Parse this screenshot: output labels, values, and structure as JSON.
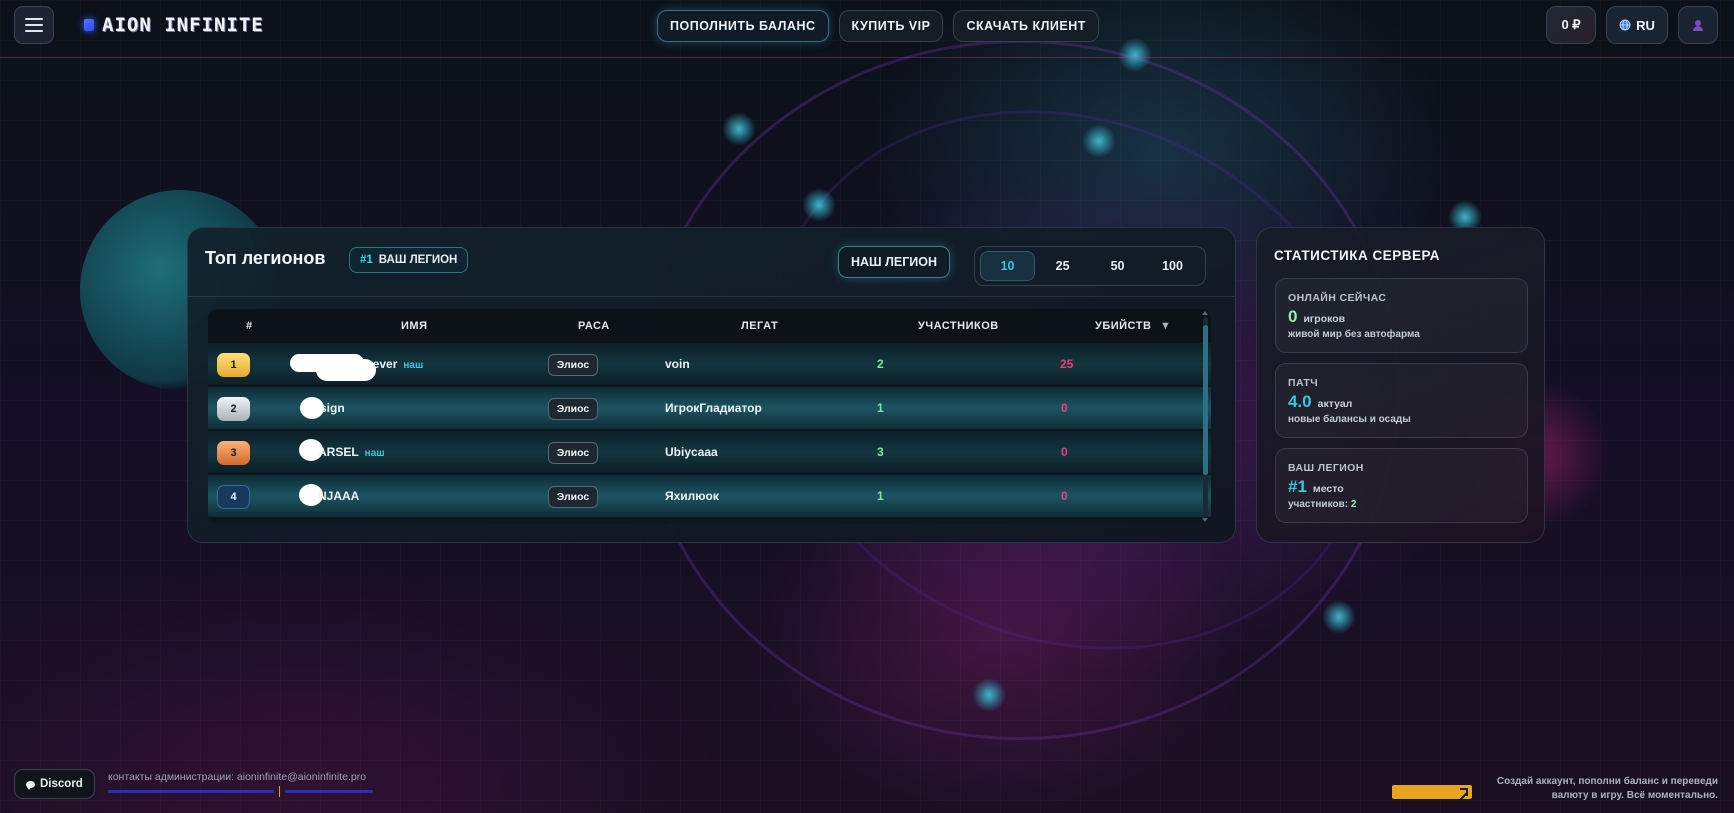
{
  "header": {
    "logo_text": "AION INFINITE",
    "nav": [
      {
        "label": "ПОПОЛНИТЬ БАЛАНС"
      },
      {
        "label": "КУПИТЬ VIP"
      },
      {
        "label": "СКАЧАТЬ КЛИЕНТ"
      }
    ],
    "balance": "0 ₽",
    "language": "RU"
  },
  "legions": {
    "title": "Топ легионов",
    "badge_rank": "#1",
    "badge_label": "ВАШ ЛЕГИОН",
    "our_button": "НАШ ЛЕГИОН",
    "limits": [
      "10",
      "25",
      "50",
      "100"
    ],
    "active_limit": "10",
    "columns": [
      "#",
      "ИМЯ",
      "РАСА",
      "ЛЕГАТ",
      "УЧАСТНИКОВ",
      "УБИЙСТВ"
    ],
    "sort_indicator": "▼",
    "rows": [
      {
        "rank": "1",
        "name": "rever",
        "our_tag": "наш",
        "race": "Элиос",
        "legate": "voin",
        "members": "2",
        "kills": "25"
      },
      {
        "rank": "2",
        "name": "sign",
        "our_tag": "",
        "race": "Элиос",
        "legate": "ИгрокГладиатор",
        "members": "1",
        "kills": "0"
      },
      {
        "rank": "3",
        "name": "ARSEL",
        "our_tag": "наш",
        "race": "Элиос",
        "legate": "Ubiycaaa",
        "members": "3",
        "kills": "0"
      },
      {
        "rank": "4",
        "name": "NJAAA",
        "our_tag": "",
        "race": "Элиос",
        "legate": "Яхилюок",
        "members": "1",
        "kills": "0"
      }
    ]
  },
  "stats": {
    "title": "СТАТИСТИКА СЕРВЕРА",
    "online": {
      "label": "ОНЛАЙН СЕЙЧАС",
      "value": "0",
      "unit": "игроков",
      "sub": "живой мир без автофарма"
    },
    "patch": {
      "label": "ПАТЧ",
      "value": "4.0",
      "unit": "актуал",
      "sub": "новые балансы и осады"
    },
    "legion": {
      "label": "ВАШ ЛЕГИОН",
      "value": "#1",
      "unit": "место",
      "sub_label": "участников:",
      "sub_value": "2"
    }
  },
  "footer": {
    "discord": "Discord",
    "contacts": "контакты администрации: aioninfinite@aioninfinite.pro",
    "promo": "Создай аккаунт, пополни баланс и переведи валюту в игру. Всё моментально."
  },
  "colors": {
    "accent": "#35c8e3",
    "members_green": "#7ee89e",
    "kills_pink": "#e83f7c",
    "gold": "#e6a92e"
  }
}
